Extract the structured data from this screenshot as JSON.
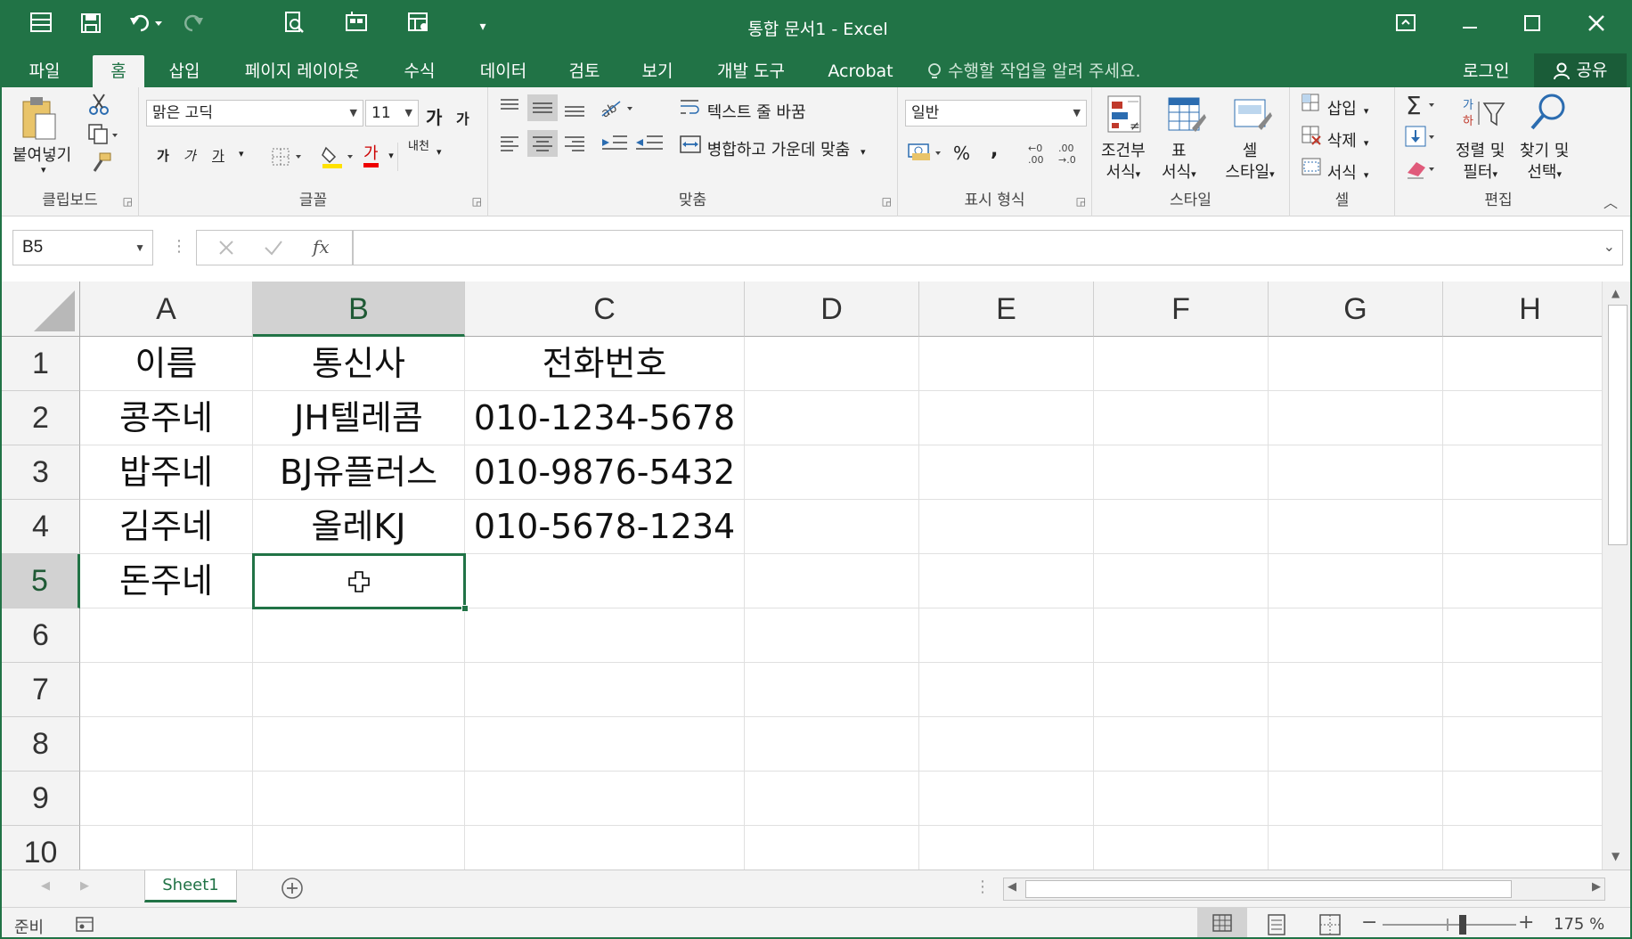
{
  "window": {
    "title": "통합 문서1 - Excel"
  },
  "quick_access": {
    "save": "💾",
    "undo": "↶",
    "redo": "↷",
    "customize": "▾"
  },
  "tabs": [
    "파일",
    "홈",
    "삽입",
    "페이지 레이아웃",
    "수식",
    "데이터",
    "검토",
    "보기",
    "개발 도구",
    "Acrobat"
  ],
  "tell_me": "수행할 작업을 알려 주세요.",
  "account": {
    "login": "로그인",
    "share": "공유"
  },
  "ribbon": {
    "clipboard": {
      "label": "클립보드",
      "paste": "붙여넣기"
    },
    "font": {
      "label": "글꼴",
      "name": "맑은 고딕",
      "size": "11",
      "bold": "가",
      "italic": "가",
      "underline": "가",
      "grow": "가",
      "shrink": "가",
      "color": "가",
      "phonetic": "내천"
    },
    "alignment": {
      "label": "맞춤",
      "wrap": "텍스트 줄 바꿈",
      "merge": "병합하고 가운데 맞춤"
    },
    "number": {
      "label": "표시 형식",
      "format": "일반",
      "percent": "%",
      "comma": ","
    },
    "styles": {
      "label": "스타일",
      "conditional_1": "조건부",
      "conditional_2": "서식",
      "table_1": "표",
      "table_2": "서식",
      "cell_1": "셀",
      "cell_2": "스타일"
    },
    "cells": {
      "label": "셀",
      "insert": "삽입",
      "delete": "삭제",
      "format": "서식"
    },
    "editing": {
      "label": "편집",
      "sort_1": "정렬 및",
      "sort_2": "필터",
      "find_1": "찾기 및",
      "find_2": "선택"
    }
  },
  "formula_bar": {
    "name_box": "B5",
    "fx": "fx",
    "formula": ""
  },
  "columns": [
    "A",
    "B",
    "C",
    "D",
    "E",
    "F",
    "G",
    "H"
  ],
  "rows": [
    "1",
    "2",
    "3",
    "4",
    "5",
    "6",
    "7",
    "8",
    "9",
    "10"
  ],
  "cells": [
    [
      "이름",
      "통신사",
      "전화번호"
    ],
    [
      "콩주네",
      "JH텔레콤",
      "010-1234-5678"
    ],
    [
      "밥주네",
      "BJ유플러스",
      "010-9876-5432"
    ],
    [
      "김주네",
      "올레KJ",
      "010-5678-1234"
    ],
    [
      "돈주네",
      "",
      ""
    ]
  ],
  "selected_cell": "B5",
  "sheets": [
    "Sheet1"
  ],
  "status": {
    "ready": "준비",
    "zoom": "175 %"
  }
}
